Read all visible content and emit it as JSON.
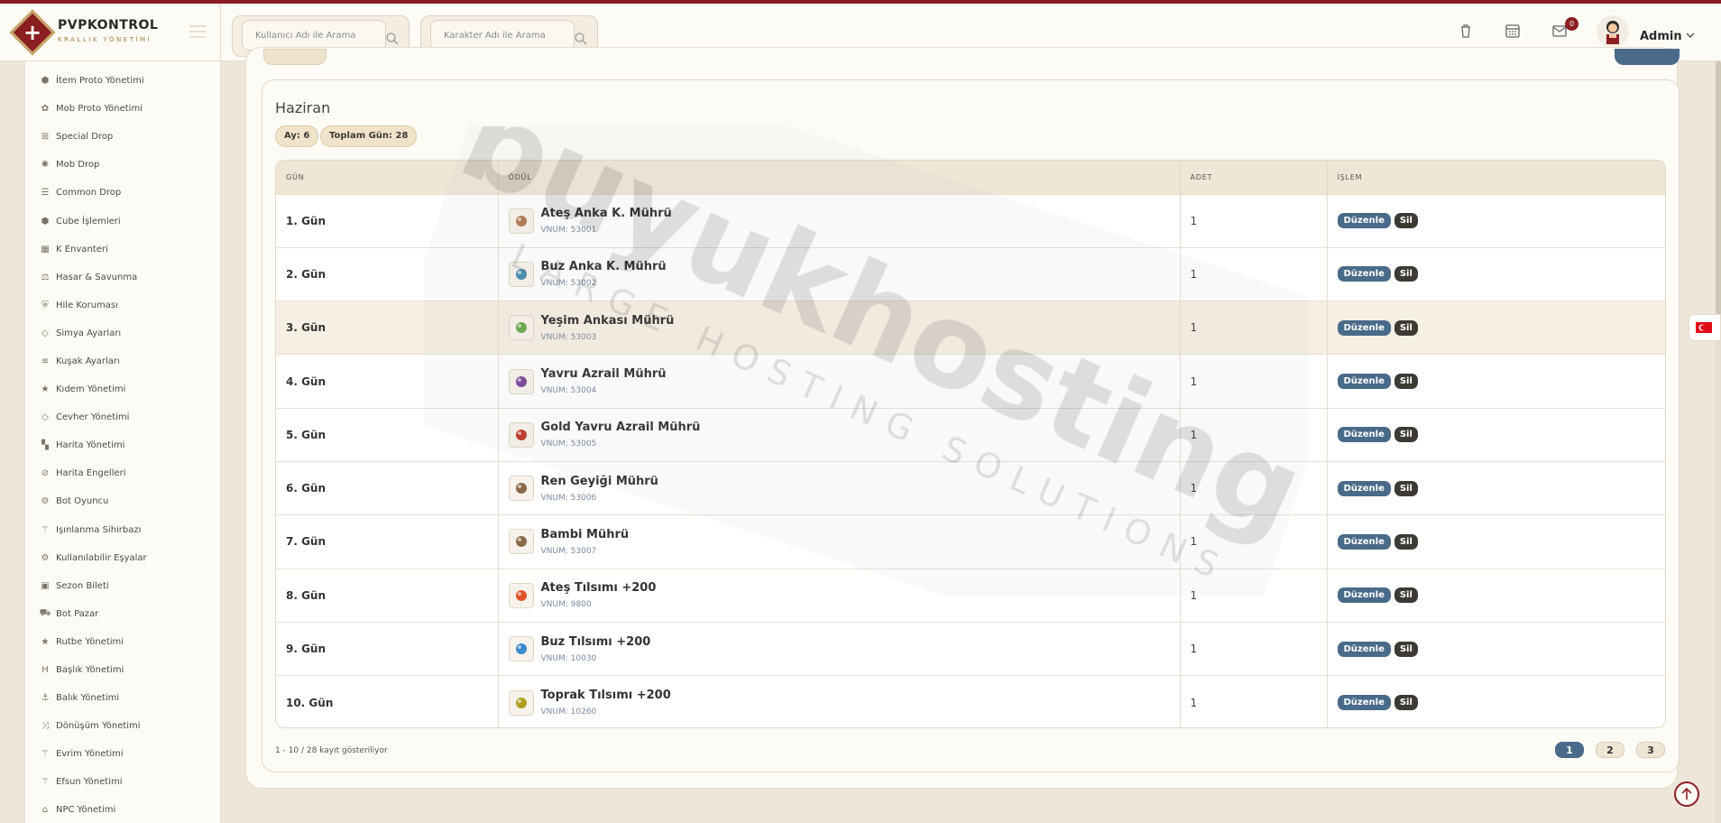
{
  "brand": {
    "title": "PVPKONTROL",
    "subtitle": "KRALLIK YÖNETİMİ"
  },
  "header": {
    "search_user_placeholder": "Kullanıcı Adı ile Arama",
    "search_char_placeholder": "Karakter Adı ile Arama",
    "notification_count": "0",
    "user_name": "Admin"
  },
  "sidebar": {
    "items": [
      {
        "label": "İtem Proto Yönetimi",
        "icon": "cube-icon"
      },
      {
        "label": "Mob Proto Yönetimi",
        "icon": "paw-icon"
      },
      {
        "label": "Special Drop",
        "icon": "gift-icon"
      },
      {
        "label": "Mob Drop",
        "icon": "bug-icon"
      },
      {
        "label": "Common Drop",
        "icon": "list-icon"
      },
      {
        "label": "Cube İşlemleri",
        "icon": "cube-icon"
      },
      {
        "label": "K Envanteri",
        "icon": "grid-icon"
      },
      {
        "label": "Hasar & Savunma",
        "icon": "scale-icon"
      },
      {
        "label": "Hile Koruması",
        "icon": "shield-icon"
      },
      {
        "label": "Simya Ayarları",
        "icon": "diamond-icon"
      },
      {
        "label": "Kuşak Ayarları",
        "icon": "sliders-icon"
      },
      {
        "label": "Kıdem Yönetimi",
        "icon": "star-icon"
      },
      {
        "label": "Cevher Yönetimi",
        "icon": "diamond-icon"
      },
      {
        "label": "Harita Yönetimi",
        "icon": "map-icon"
      },
      {
        "label": "Harita Engelleri",
        "icon": "ban-icon"
      },
      {
        "label": "Bot Oyuncu",
        "icon": "robot-icon"
      },
      {
        "label": "Işınlanma Sihirbazı",
        "icon": "wand-icon"
      },
      {
        "label": "Kullanılabilir Eşyalar",
        "icon": "cogs-icon"
      },
      {
        "label": "Sezon Bileti",
        "icon": "ticket-icon"
      },
      {
        "label": "Bot Pazar",
        "icon": "cart-icon"
      },
      {
        "label": "Rutbe Yönetimi",
        "icon": "star-icon"
      },
      {
        "label": "Başlık Yönetimi",
        "icon": "heading-icon"
      },
      {
        "label": "Balık Yönetimi",
        "icon": "anchor-icon"
      },
      {
        "label": "Dönüşüm Yönetimi",
        "icon": "shuffle-icon"
      },
      {
        "label": "Evrim Yönetimi",
        "icon": "wand-icon"
      },
      {
        "label": "Efsun Yönetimi",
        "icon": "wand-icon"
      },
      {
        "label": "NPC Yönetimi",
        "icon": "building-icon"
      }
    ]
  },
  "card": {
    "title": "Haziran",
    "month_pill": "Ay: 6",
    "total_days_pill": "Toplam Gün: 28"
  },
  "table": {
    "columns": [
      "GÜN",
      "ÖDÜL",
      "ADET",
      "İŞLEM"
    ],
    "edit_label": "Düzenle",
    "delete_label": "Sil",
    "rows": [
      {
        "day": "1. Gün",
        "name": "Ateş Anka K. Mührü",
        "vnum": "VNUM: 53001",
        "qty": "1",
        "icon_color": "#b07a55"
      },
      {
        "day": "2. Gün",
        "name": "Buz Anka K. Mührü",
        "vnum": "VNUM: 53002",
        "qty": "1",
        "icon_color": "#4a90b0"
      },
      {
        "day": "3. Gün",
        "name": "Yeşim Ankası Mührü",
        "vnum": "VNUM: 53003",
        "qty": "1",
        "icon_color": "#6aa84f"
      },
      {
        "day": "4. Gün",
        "name": "Yavru Azrail Mührü",
        "vnum": "VNUM: 53004",
        "qty": "1",
        "icon_color": "#7a4a9a"
      },
      {
        "day": "5. Gün",
        "name": "Gold Yavru Azrail Mührü",
        "vnum": "VNUM: 53005",
        "qty": "1",
        "icon_color": "#c0392b"
      },
      {
        "day": "6. Gün",
        "name": "Ren Geyiği Mührü",
        "vnum": "VNUM: 53006",
        "qty": "1",
        "icon_color": "#8a6a4a"
      },
      {
        "day": "7. Gün",
        "name": "Bambi Mührü",
        "vnum": "VNUM: 53007",
        "qty": "1",
        "icon_color": "#8a6a4a"
      },
      {
        "day": "8. Gün",
        "name": "Ateş Tılsımı +200",
        "vnum": "VNUM: 9800",
        "qty": "1",
        "icon_color": "#e0562a"
      },
      {
        "day": "9. Gün",
        "name": "Buz Tılsımı +200",
        "vnum": "VNUM: 10030",
        "qty": "1",
        "icon_color": "#3a8ad0"
      },
      {
        "day": "10. Gün",
        "name": "Toprak Tılsımı +200",
        "vnum": "VNUM: 10260",
        "qty": "1",
        "icon_color": "#b0a020"
      }
    ]
  },
  "footer": {
    "info": "1 - 10 / 28 kayıt gösteriliyor",
    "pages": [
      "1",
      "2",
      "3"
    ],
    "active_page": "1"
  },
  "watermark": {
    "main": "buyukhosting",
    "sub": "LARGE HOSTING SOLUTIONS"
  },
  "colors": {
    "accent": "#8b1e22",
    "primary_button": "#4a6a8a",
    "dark_button": "#3d3a34",
    "pill_bg": "#f1e3c9"
  }
}
